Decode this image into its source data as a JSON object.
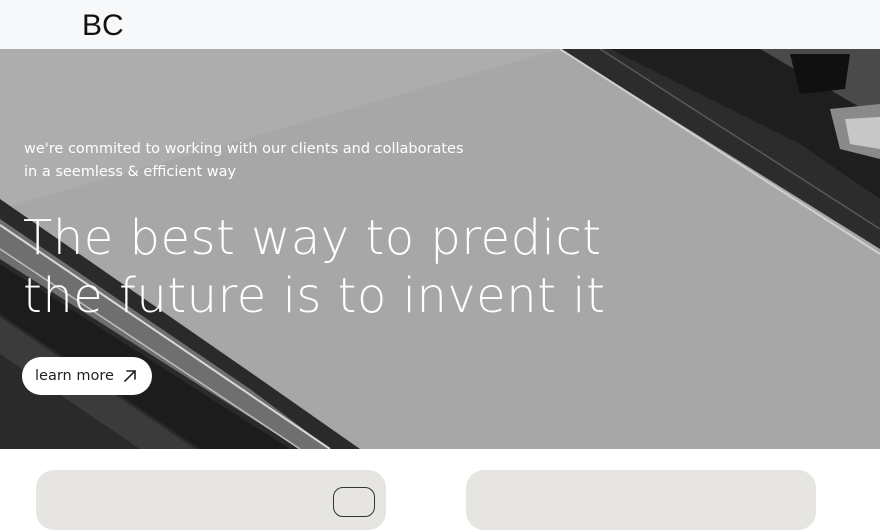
{
  "header": {
    "logo": "BC"
  },
  "hero": {
    "tagline": [
      "we're commited to working with our clients and collaborates",
      "in a seemless & efficient way"
    ],
    "headline": [
      "The best way to predict",
      "the future is to invent it"
    ],
    "cta_label": "learn more",
    "cta_icon": "arrow-up-right-icon"
  },
  "colors": {
    "header_bg": "#f7f8fa",
    "hero_bg": "#a6a6a6",
    "card_bg": "#e6e5e1",
    "button_bg": "#ffffff"
  }
}
